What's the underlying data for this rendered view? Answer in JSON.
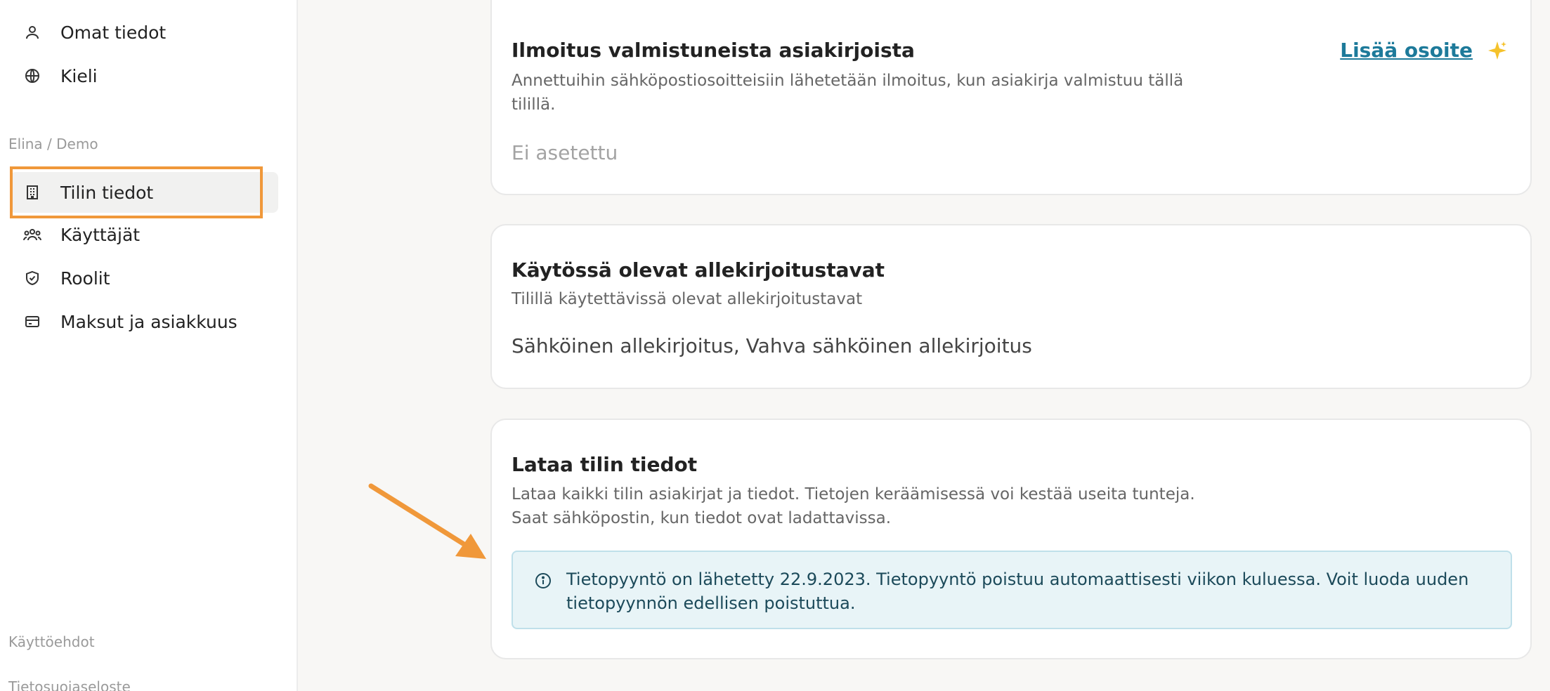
{
  "sidebar": {
    "personal_items": [
      {
        "label": "Omat tiedot",
        "icon": "person-icon"
      },
      {
        "label": "Kieli",
        "icon": "globe-icon"
      }
    ],
    "section_label": "Elina / Demo",
    "account_items": [
      {
        "label": "Tilin tiedot",
        "icon": "building-icon",
        "active": true
      },
      {
        "label": "Käyttäjät",
        "icon": "users-icon"
      },
      {
        "label": "Roolit",
        "icon": "shield-icon"
      },
      {
        "label": "Maksut ja asiakkuus",
        "icon": "card-icon"
      }
    ],
    "footer": {
      "terms": "Käyttöehdot",
      "cut_off": "Tietosuojaseloste"
    }
  },
  "notifications_card": {
    "title": "Ilmoitus valmistuneista asiakirjoista",
    "description": "Annettuihin sähköpostiosoitteisiin lähetetään ilmoitus, kun asiakirja valmistuu tällä tilillä.",
    "value": "Ei asetettu",
    "add_link": "Lisää osoite",
    "add_icon": "sparkle-icon"
  },
  "signatures_card": {
    "title": "Käytössä olevat allekirjoitustavat",
    "description": "Tilillä käytettävissä olevat allekirjoitustavat",
    "value": "Sähköinen allekirjoitus, Vahva sähköinen allekirjoitus"
  },
  "download_card": {
    "title": "Lataa tilin tiedot",
    "description_line1": "Lataa kaikki tilin asiakirjat ja tiedot. Tietojen keräämisessä voi kestää useita tunteja.",
    "description_line2": "Saat sähköpostin, kun tiedot ovat ladattavissa.",
    "info_icon": "info-icon",
    "info_text": "Tietopyyntö on lähetetty 22.9.2023. Tietopyyntö poistuu automaattisesti viikon kuluessa. Voit luoda uuden tietopyynnön edellisen poistuttua."
  },
  "colors": {
    "highlight": "#f0983a",
    "link": "#1d7a9a",
    "info_bg": "#e8f4f7",
    "info_text": "#1c4a5a",
    "sparkle": "#f5c22b"
  }
}
